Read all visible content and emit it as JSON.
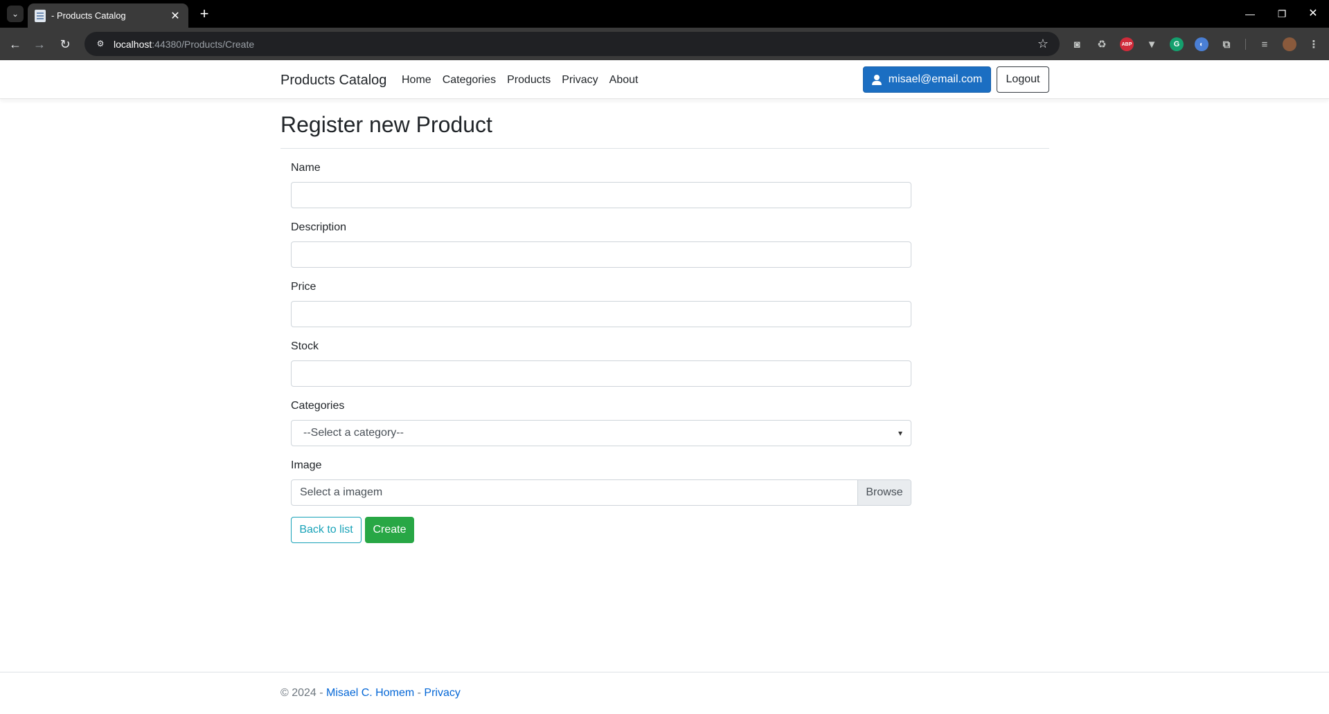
{
  "browser": {
    "tab_title": "- Products Catalog",
    "url_host": "localhost",
    "url_rest": ":44380/Products/Create"
  },
  "header": {
    "brand": "Products Catalog",
    "nav": [
      "Home",
      "Categories",
      "Products",
      "Privacy",
      "About"
    ],
    "user_email": "misael@email.com",
    "logout_label": "Logout"
  },
  "main": {
    "title": "Register new Product",
    "fields": {
      "name_label": "Name",
      "name_value": "",
      "description_label": "Description",
      "description_value": "",
      "price_label": "Price",
      "price_value": "",
      "stock_label": "Stock",
      "stock_value": "",
      "categories_label": "Categories",
      "categories_selected": "--Select a category--",
      "image_label": "Image",
      "image_placeholder": "Select a imagem",
      "browse_label": "Browse"
    },
    "back_label": "Back to list",
    "create_label": "Create"
  },
  "footer": {
    "copyright": "© 2024 - ",
    "author": "Misael C. Homem",
    "separator": " - ",
    "privacy": "Privacy"
  },
  "colors": {
    "primary": "#1b6ec2",
    "success": "#28a745",
    "info": "#17a2b8",
    "link": "#0366d6"
  }
}
